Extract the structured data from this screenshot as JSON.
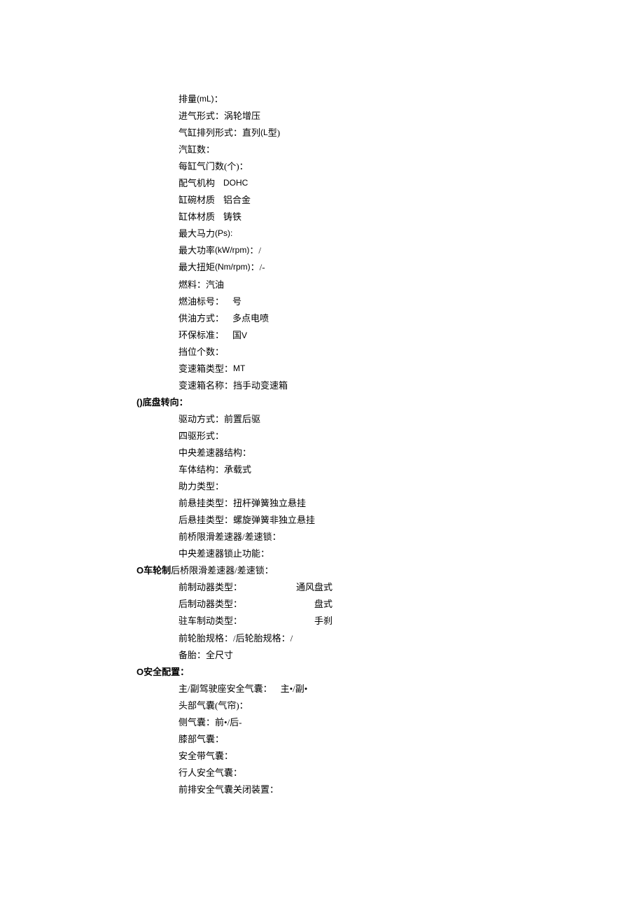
{
  "engine": {
    "displacement_label": "排量",
    "displacement_unit": "(mL)",
    "colon": "：",
    "intake_label": "进气形式：",
    "intake_value": "涡轮增压",
    "cyl_arr_label": "气缸排列形式：",
    "cyl_arr_value_pre": "直列",
    "cyl_arr_value_latin": "(L",
    "cyl_arr_value_suf": "型)",
    "cyl_count_label": "汽缸数：",
    "valves_label": "每缸气门数(个)：",
    "valve_train_label": "配气机构",
    "valve_train_value": "DOHC",
    "head_mat_label": "缸碗材质",
    "head_mat_value": "铝合金",
    "block_mat_label": "缸体材质",
    "block_mat_value": "铸铁",
    "max_hp_label": "最大马力",
    "max_hp_unit": "(Ps):",
    "max_power_label": "最大功率",
    "max_power_unit": "(kW/rpm)",
    "max_power_suffix": "：/",
    "max_torque_label": "最大扭矩",
    "max_torque_unit": "(Nm/rpm)",
    "max_torque_suffix": "：/-",
    "fuel_label": "燃料：",
    "fuel_value": "汽油",
    "fuel_num_label": "燃油标号：",
    "fuel_num_value": "号",
    "fuel_supply_label": "供油方式：",
    "fuel_supply_value": "多点电喷",
    "emission_label": "环保标准：",
    "emission_value_pre": "国",
    "emission_value_latin": "V",
    "gears_label": "挡位个数：",
    "trans_type_label": "变速箱类型：",
    "trans_type_value": "MT",
    "trans_name_label": "变速箱名称：",
    "trans_name_value": "挡手动变速箱"
  },
  "chassis": {
    "header_prefix": "()",
    "header": "底盘转向：",
    "drive_label": "驱动方式：",
    "drive_value": "前置后驱",
    "awd_label": "四驱形式：",
    "center_diff_label": "中央差速器结构：",
    "body_struct_label": "车体结构：",
    "body_struct_value": "承载式",
    "assist_label": "助力类型：",
    "front_susp_label": "前悬挂类型：",
    "front_susp_value": "扭杆弹簧独立悬挂",
    "rear_susp_label": "后悬挂类型：",
    "rear_susp_value": "螺旋弹簧非独立悬挂",
    "front_lsd_label": "前桥限滑差速器/差速锁：",
    "center_lock_label": "中央差速器锁止功能："
  },
  "brakes": {
    "header_prefix": "O",
    "header_interleave": "车轮制",
    "header_inserted": "后桥限滑差速器/差速锁：",
    "front_brake_label": "前制动器类型：",
    "front_brake_value": "通风盘式",
    "rear_brake_label": "后制动器类型：",
    "rear_brake_value": "盘式",
    "park_brake_label": "驻车制动类型：",
    "park_brake_value": "手刹",
    "tire_line": "前轮胎规格：/后轮胎规格：/备胎：全尺寸"
  },
  "safety": {
    "header_prefix": "O",
    "header": "安全配置：",
    "main_airbag_label": "主/副驾驶座安全气囊：",
    "main_airbag_value": "主•/副•",
    "head_airbag_label": "头部气囊(气帘)：",
    "side_airbag_label": "侧气囊：",
    "side_airbag_value": "前•/后-",
    "knee_airbag_label": "膝部气囊：",
    "seatbelt_airbag_label": "安全带气囊：",
    "pedestrian_airbag_label": "行人安全气囊：",
    "front_airbag_off_label": "前排安全气囊关闭装置："
  }
}
